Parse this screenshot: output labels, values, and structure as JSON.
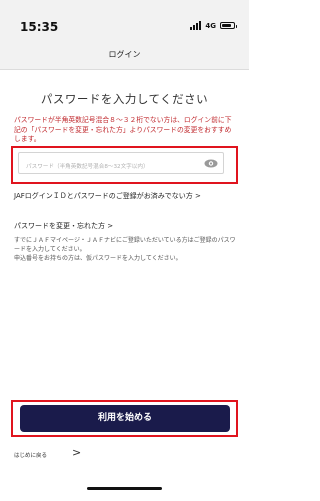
{
  "status_bar": {
    "time": "15:35",
    "network": "4G",
    "icons": [
      "signal-icon",
      "battery-icon"
    ]
  },
  "nav": {
    "title": "ログイン"
  },
  "main": {
    "heading": "パスワードを入力してください",
    "notice": "パスワードが半角英数記号混合８～３２桁でない方は、ログイン前に下記の「パスワードを変更・忘れた方」よりパスワードの変更をおすすめします。",
    "password": {
      "placeholder": "パスワード（半角英数記号混合8～32文字以内）",
      "value": "",
      "toggle_icon": "eye-icon"
    },
    "info": "JAFログインＩＤとパスワードのご登録がお済みでない方 >",
    "change_link": "パスワードを変更・忘れた方 >",
    "help": "すでにＪＡＦマイページ・ＪＡＦナビにご登録いただいている方はご登録のパスワードを入力してください。\n申込番号をお持ちの方は、仮パスワードを入力してください。",
    "start_button": "利用を始める",
    "back_label": "はじめに戻る",
    "back_chevron": ">"
  },
  "colors": {
    "notice_red": "#c0282d",
    "highlight_red": "#e0141e",
    "button_navy": "#1a1b4b",
    "header_gray": "#f2f2f2"
  }
}
